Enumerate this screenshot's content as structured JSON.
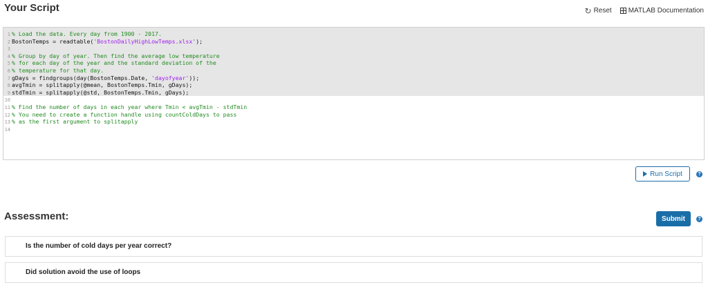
{
  "script_panel": {
    "title": "Your Script",
    "reset_label": "Reset",
    "docs_label": "MATLAB Documentation"
  },
  "editor": {
    "lines": [
      {
        "n": "1",
        "comment": "% Load the data. Every day from 1900 - 2017."
      },
      {
        "n": "2",
        "code_pre": "BostonTemps = readtable(",
        "str": "'BostonDailyHighLowTemps.xlsx'",
        "code_post": ");"
      },
      {
        "n": "3"
      },
      {
        "n": "4",
        "comment": "% Group by day of year. Then find the average low temperature"
      },
      {
        "n": "5",
        "comment": "% for each day of the year and the standard deviation of the"
      },
      {
        "n": "6",
        "comment": "% temperature for that day."
      },
      {
        "n": "7",
        "code_pre": "gDays = findgroups(day(BostonTemps.Date, ",
        "str": "'dayofyear'",
        "code_post": "));"
      },
      {
        "n": "8",
        "code_pre": "avgTmin = splitapply(@mean, BostonTemps.Tmin, gDays);"
      },
      {
        "n": "9",
        "code_pre": "stdTmin = splitapply(@std, BostonTemps.Tmin, gDays);"
      },
      {
        "n": "10"
      },
      {
        "n": "11",
        "comment": "% Find the number of days in each year where Tmin < avgTmin - stdTmin"
      },
      {
        "n": "12",
        "comment": "% You need to create a function handle using countColdDays to pass"
      },
      {
        "n": "13",
        "comment": "% as the first argument to splitapply"
      },
      {
        "n": "14"
      }
    ]
  },
  "run": {
    "label": "Run Script"
  },
  "assessment": {
    "title": "Assessment:",
    "submit_label": "Submit",
    "checks": [
      "Is the number of cold days per year correct?",
      "Did solution avoid the use of loops"
    ]
  },
  "colors": {
    "accent": "#1a6ea8",
    "comment": "#228b22",
    "string": "#a020f0",
    "highlight_bg": "#e6e6e6"
  },
  "icons": [
    "reset-icon",
    "matlab-doc-icon",
    "play-icon",
    "help-icon"
  ]
}
